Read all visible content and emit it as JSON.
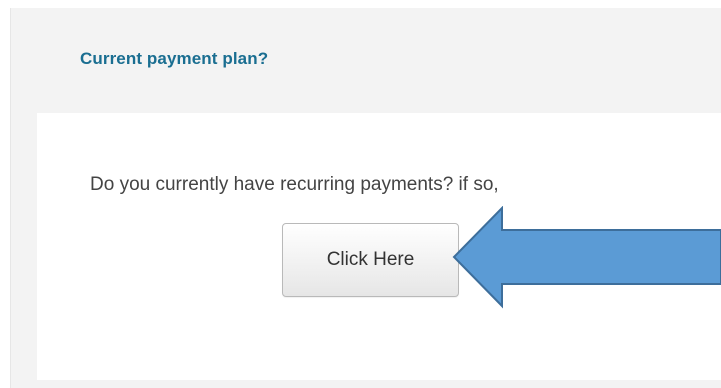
{
  "panel": {
    "heading": "Current payment plan?",
    "question": "Do you currently have recurring payments? if so,",
    "button_label": "Click Here"
  },
  "colors": {
    "heading": "#1a6e91",
    "arrow_fill": "#5b9bd5",
    "arrow_stroke": "#3d6e9b",
    "panel_bg": "#f3f3f3"
  },
  "annotation": {
    "icon": "arrow-left-icon"
  }
}
